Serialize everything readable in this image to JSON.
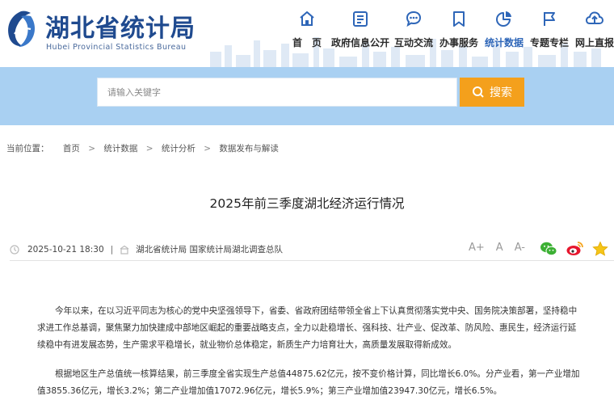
{
  "header": {
    "site_title": "湖北省统计局",
    "site_subtitle": "Hubei Provincial Statistics Bureau",
    "nav": [
      {
        "label": "首　页",
        "icon": "home-icon"
      },
      {
        "label": "政府信息公开",
        "icon": "document-icon"
      },
      {
        "label": "互动交流",
        "icon": "chat-icon"
      },
      {
        "label": "办事服务",
        "icon": "bookmark-icon"
      },
      {
        "label": "统计数据",
        "icon": "pie-chart-icon",
        "active": true
      },
      {
        "label": "专题专栏",
        "icon": "flag-icon"
      },
      {
        "label": "网上直报",
        "icon": "cloud-upload-icon"
      }
    ],
    "active_color": "#2e66b8",
    "brand_color": "#1f4a8f"
  },
  "search": {
    "placeholder": "请输入关键字",
    "button_label": "搜索",
    "button_color": "#f4a01c",
    "banner_color": "#a9d0f2"
  },
  "breadcrumb": {
    "prefix": "当前位置：",
    "items": [
      "首页",
      "统计数据",
      "统计分析",
      "数据发布与解读"
    ]
  },
  "article": {
    "title": "2025年前三季度湖北经济运行情况",
    "date": "2025-10-21 18:30",
    "source": "湖北省统计局 国家统计局湖北调查总队",
    "font_size_labels": [
      "A+",
      "A",
      "A-"
    ],
    "share_icons": [
      "wechat-icon",
      "weibo-icon",
      "favorite-star-icon"
    ],
    "paragraphs": [
      [
        "今年以来，在以习近平同志为核心的党中央坚强领导下，省委、省政府团结带领全省上下认真贯彻落实党中央、国务院决策部署，坚持稳中",
        "求进工作总基调，聚焦聚力加快建成中部地区崛起的重要战略支点，全力以赴稳增长、强科技、壮产业、促改革、防风险、惠民生，经济运行延",
        "续稳中有进发展态势，生产需求平稳增长，就业物价总体稳定，新质生产力培育壮大，高质量发展取得新成效。"
      ],
      [
        "根据地区生产总值统一核算结果，前三季度全省实现生产总值44875.62亿元，按不变价格计算，同比增长6.0%。分产业看，第一产业增加",
        "值3855.36亿元，增长3.2%；第二产业增加值17072.96亿元，增长5.9%；第三产业增加值23947.30亿元，增长6.5%。"
      ]
    ]
  }
}
